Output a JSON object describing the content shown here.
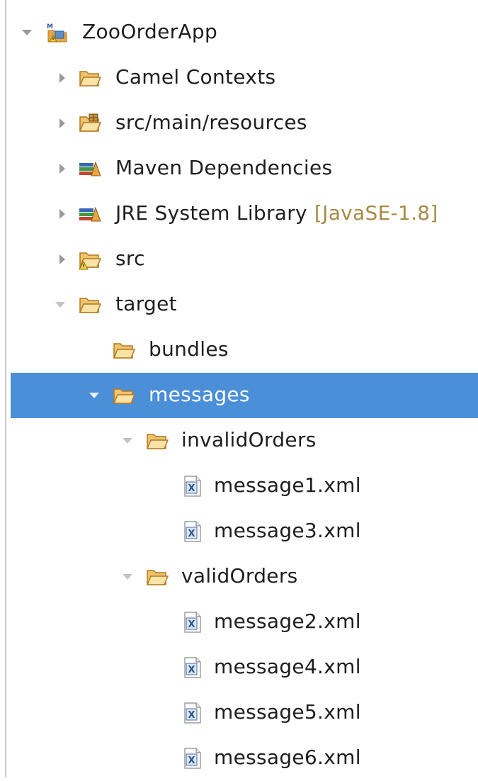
{
  "tree": {
    "project": {
      "label": "ZooOrderApp",
      "expanded": true,
      "icon": "maven-project-icon"
    },
    "camel_contexts": {
      "label": "Camel Contexts",
      "expanded": false,
      "icon": "folder-icon"
    },
    "resources": {
      "label": "src/main/resources",
      "expanded": false,
      "icon": "package-folder-icon"
    },
    "maven_deps": {
      "label": "Maven Dependencies",
      "expanded": false,
      "icon": "library-icon"
    },
    "jre": {
      "label": "JRE System Library",
      "decoration": "[JavaSE-1.8]",
      "expanded": false,
      "icon": "library-icon"
    },
    "src": {
      "label": "src",
      "expanded": false,
      "icon": "warning-folder-icon"
    },
    "target": {
      "label": "target",
      "expanded": true,
      "icon": "folder-icon"
    },
    "bundles": {
      "label": "bundles",
      "icon": "folder-icon"
    },
    "messages": {
      "label": "messages",
      "expanded": true,
      "selected": true,
      "icon": "folder-icon"
    },
    "invalid_orders": {
      "label": "invalidOrders",
      "expanded": true,
      "icon": "folder-icon"
    },
    "invalid_files": [
      {
        "label": "message1.xml",
        "icon": "xml-file-icon"
      },
      {
        "label": "message3.xml",
        "icon": "xml-file-icon"
      }
    ],
    "valid_orders": {
      "label": "validOrders",
      "expanded": true,
      "icon": "folder-icon"
    },
    "valid_files": [
      {
        "label": "message2.xml",
        "icon": "xml-file-icon"
      },
      {
        "label": "message4.xml",
        "icon": "xml-file-icon"
      },
      {
        "label": "message5.xml",
        "icon": "xml-file-icon"
      },
      {
        "label": "message6.xml",
        "icon": "xml-file-icon"
      }
    ]
  },
  "colors": {
    "selection": "#4a8fd8",
    "folder": "#e8a542",
    "decoration": "#a88a45"
  }
}
